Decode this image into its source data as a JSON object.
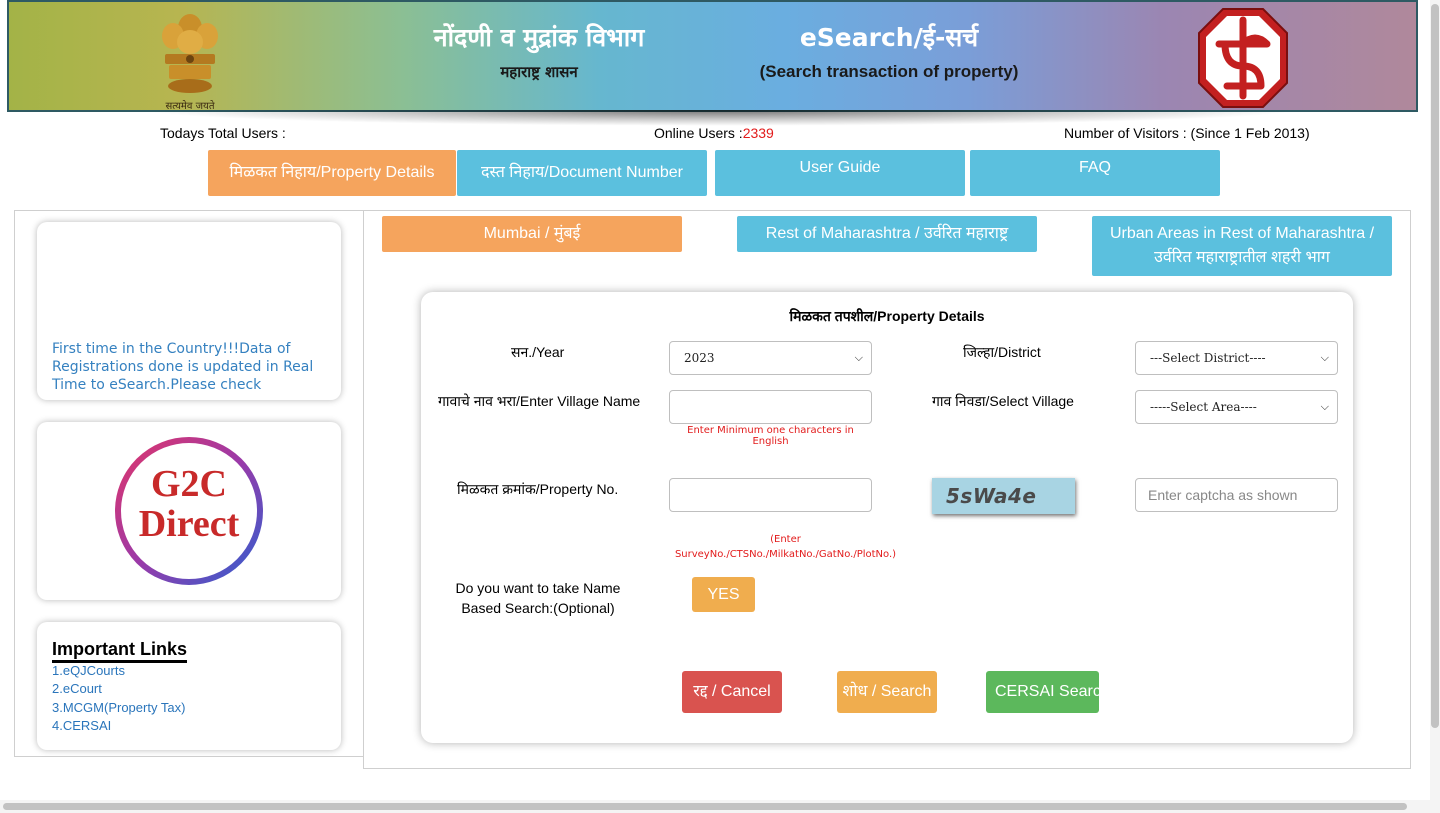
{
  "header": {
    "emblem_caption": "सत्यमेव जयते",
    "title_marathi": "नोंदणी व मुद्रांक विभाग",
    "subtitle_marathi": "महाराष्ट्र शासन",
    "title_esearch": "eSearch/ई-सर्च",
    "subtitle_esearch": "(Search transaction of property)"
  },
  "stats": {
    "today_label": "Todays Total Users :",
    "online_label": "Online Users :",
    "online_value": "2339",
    "visitors_label": "Number of Visitors : (Since 1 Feb 2013)"
  },
  "main_tabs": [
    {
      "label": "मिळकत निहाय/Property Details",
      "active": true
    },
    {
      "label": "दस्त निहाय/Document Number",
      "active": false
    },
    {
      "label": "User Guide",
      "active": false
    },
    {
      "label": "FAQ",
      "active": false
    }
  ],
  "sidebar": {
    "news_text": "First time in the Country!!!Data of Registrations done is updated in Real Time to eSearch.Please check",
    "g2c_line1": "G2C",
    "g2c_line2": "Direct",
    "links_title": "Important Links",
    "links": [
      "1.eQJCourts",
      "2.eCourt",
      "3.MCGM(Property Tax)",
      "4.CERSAI"
    ]
  },
  "regions": {
    "mumbai": "Mumbai / मुंबई",
    "rest": "Rest of Maharashtra / उर्वरित महाराष्ट्र",
    "urban_line1": "Urban Areas in Rest of Maharashtra /",
    "urban_line2": "उर्वरित महाराष्ट्रातील शहरी भाग"
  },
  "form": {
    "title": "मिळकत तपशील/Property Details",
    "year_label": "सन./Year",
    "year_value": "2023",
    "district_label": "जिल्हा/District",
    "district_value": "---Select District----",
    "village_name_label": "गावाचे नाव भरा/Enter Village Name",
    "village_name_hint": "Enter Minimum one characters in English",
    "select_village_label": "गाव निवडा/Select Village",
    "select_village_value": "-----Select Area----",
    "property_no_label": "मिळकत क्रमांक/Property No.",
    "property_no_hint_1": "(Enter",
    "property_no_hint_2": "SurveyNo./CTSNo./MilkatNo./GatNo./PlotNo.)",
    "captcha_text": "5sWa4e",
    "captcha_placeholder": "Enter captcha as shown",
    "name_search_line1": "Do you want to take Name",
    "name_search_line2": "Based Search:(Optional)",
    "yes_label": "YES",
    "cancel_label": "रद्द / Cancel",
    "search_label": "शोध / Search",
    "cersai_label": "CERSAI Search"
  },
  "colors": {
    "orange": "#f5a45d",
    "blue": "#5bc0de",
    "red_btn": "#d9534f",
    "yellow_btn": "#f0ad4e",
    "green_btn": "#5cb85c",
    "link": "#2a75bb",
    "alert_red": "#e21b1b"
  }
}
